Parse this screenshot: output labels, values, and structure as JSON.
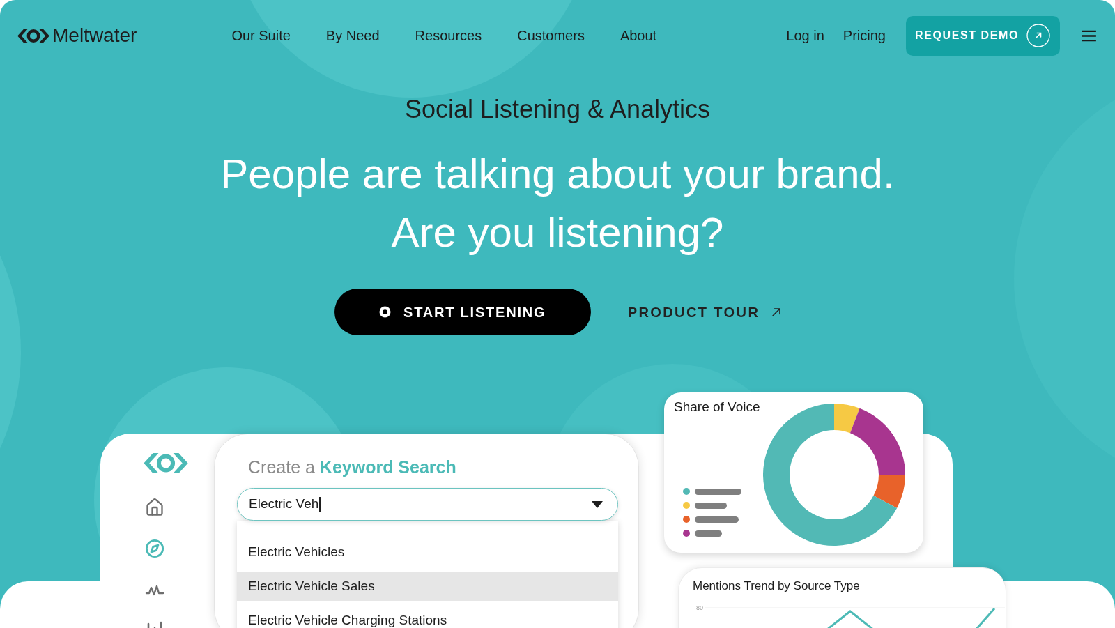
{
  "header": {
    "logo_text": "Meltwater",
    "nav": [
      "Our Suite",
      "By Need",
      "Resources",
      "Customers",
      "About"
    ],
    "login": "Log in",
    "pricing": "Pricing",
    "request_demo": "REQUEST DEMO"
  },
  "hero": {
    "eyebrow": "Social Listening & Analytics",
    "headline": [
      "People are talking about your brand.",
      "Are you listening?"
    ],
    "primary_button": "START LISTENING",
    "secondary_link": "PRODUCT TOUR"
  },
  "dashboard": {
    "sidebar": {
      "items": [
        {
          "selected": false
        },
        {
          "selected": true
        },
        {
          "selected": false
        },
        {
          "selected": false
        }
      ]
    },
    "keyword_search": {
      "title": "Create a **Keyword Search**",
      "value": "Electric Veh",
      "suggestions": [
        {
          "label": "Electric Vehicles",
          "selected": false
        },
        {
          "label": "Electric Vehicle Sales",
          "selected": true
        },
        {
          "label": "Electric Vehicle Charging Stations",
          "selected": false
        }
      ]
    },
    "share_of_voice": {
      "title": "Share of Voice",
      "legend": [
        {
          "color": "#52b9b5"
        },
        {
          "color": "#f6c944"
        },
        {
          "color": "#e8622a"
        },
        {
          "color": "#a8358f"
        }
      ]
    },
    "mentions_trend": {
      "title": "Mentions Trend by Source Type",
      "y_tick_label": "80"
    }
  }
}
